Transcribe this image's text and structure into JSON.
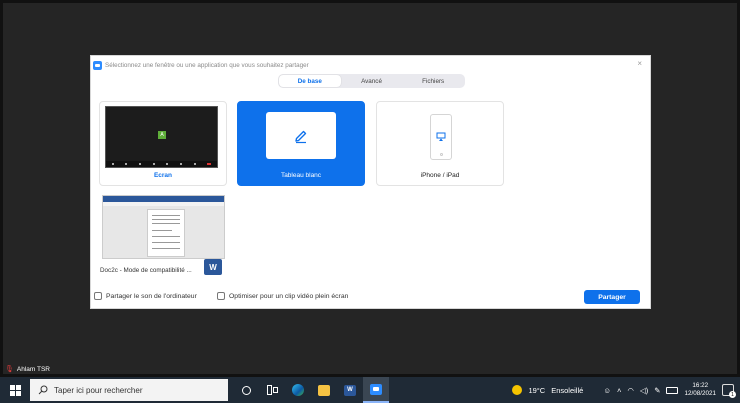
{
  "dialog": {
    "title": "Sélectionnez une fenêtre ou une application que vous souhaitez partager",
    "close_glyph": "×",
    "tabs": [
      "De base",
      "Avancé",
      "Fichiers"
    ],
    "active_tab": "De base",
    "tiles": {
      "screen": {
        "label": "Écran",
        "avatar_letter": "A"
      },
      "whiteboard": {
        "label": "Tableau blanc",
        "icon": "pencil-icon"
      },
      "iphone": {
        "label": "iPhone / iPad",
        "icon": "airplay-phone-icon"
      },
      "document": {
        "label": "Doc2c  -  Mode de compatibilité ...",
        "app_letter": "W"
      }
    },
    "footer": {
      "share_sound": "Partager le son de l'ordinateur",
      "optimize_video": "Optimiser pour un clip vidéo plein écran",
      "share_button": "Partager"
    }
  },
  "participant": {
    "name": "Ahlam TSR",
    "mic_icon": "mic-muted-icon"
  },
  "taskbar": {
    "search_placeholder": "Taper ici pour rechercher",
    "weather_temp": "19°C",
    "weather_text": "Ensoleillé",
    "time": "16:22",
    "date": "12/08/2021",
    "notification_count": "1",
    "word_letter": "W"
  },
  "colors": {
    "accent": "#0e71eb",
    "background": "#252525",
    "taskbar": "#1f2a36"
  }
}
